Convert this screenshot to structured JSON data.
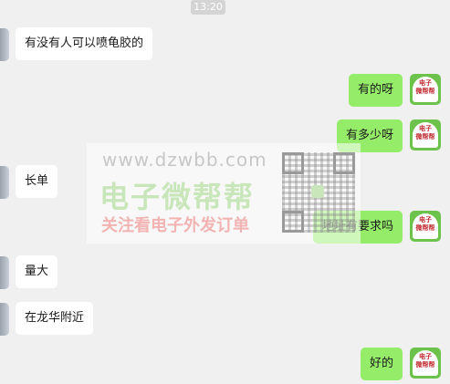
{
  "chat": {
    "timestamp": "13:20",
    "messages": [
      {
        "side": "left",
        "text": "有没有人可以喷龟胶的"
      },
      {
        "side": "right",
        "text": "有的呀"
      },
      {
        "side": "right",
        "text": "有多少呀"
      },
      {
        "side": "left",
        "text": "长单"
      },
      {
        "side": "right",
        "text": "地址有要求吗"
      },
      {
        "side": "left",
        "text": "量大"
      },
      {
        "side": "left",
        "text": "在龙华附近"
      },
      {
        "side": "right",
        "text": "好的"
      }
    ]
  },
  "avatar": {
    "line1": "电子",
    "line2": "微帮帮"
  },
  "watermark": {
    "url": "www.dzwbb.com",
    "brand": "电子微帮帮",
    "slogan": "关注看电子外发订单"
  }
}
